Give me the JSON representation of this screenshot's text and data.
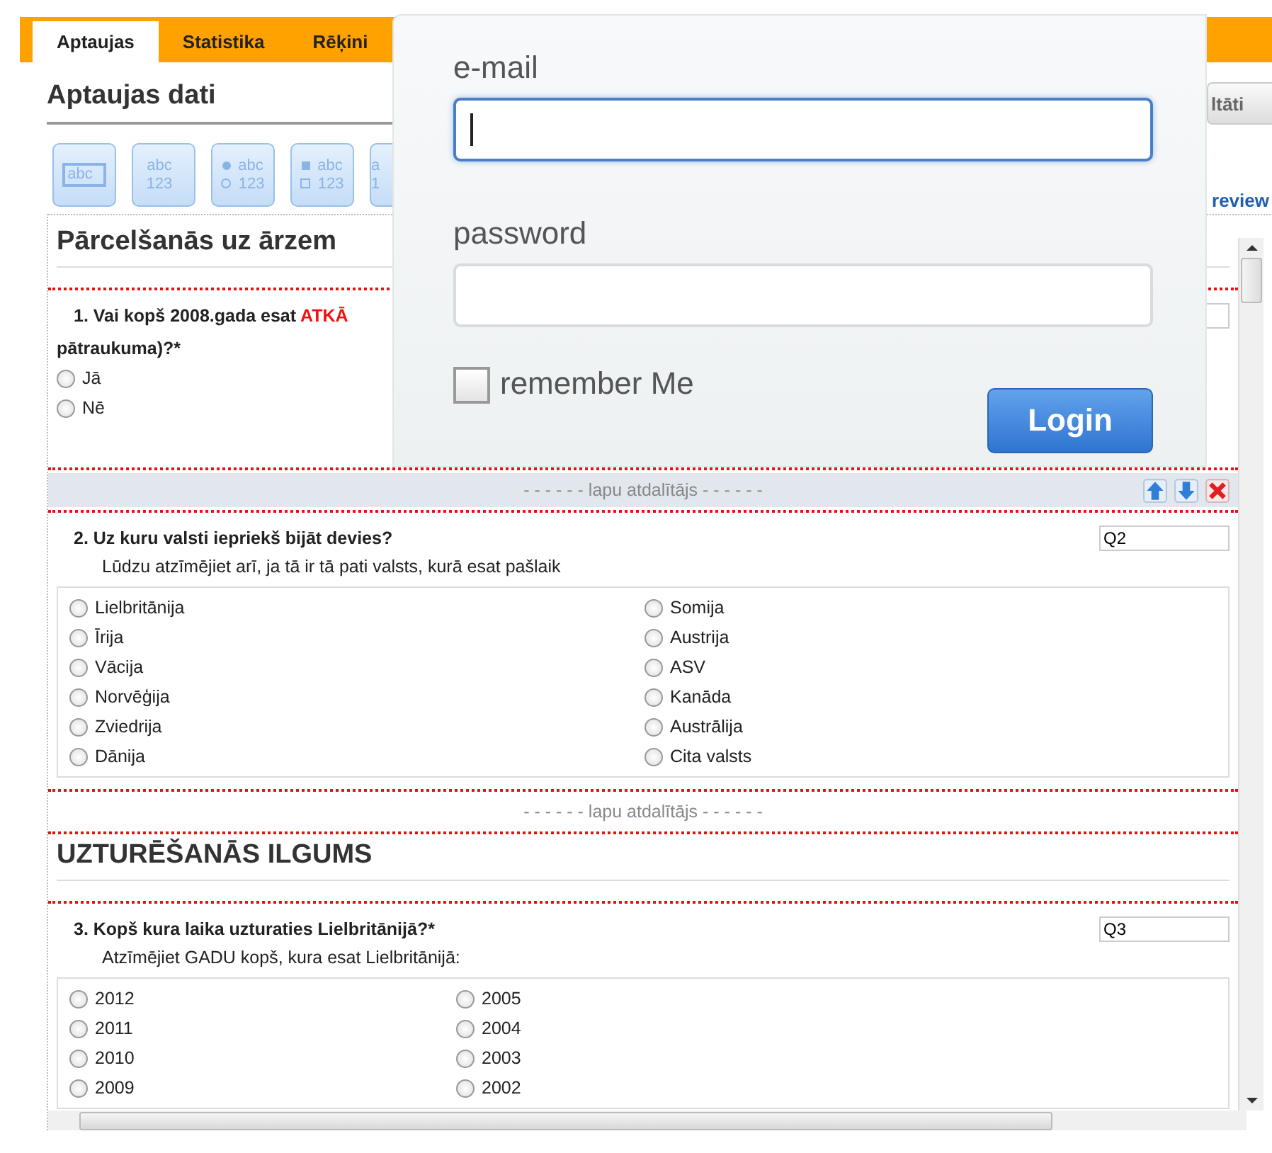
{
  "tabs": [
    {
      "label": "Aptaujas",
      "selected": true
    },
    {
      "label": "Statistika",
      "selected": false
    },
    {
      "label": "Rēķini",
      "selected": false
    }
  ],
  "page_title": "Aptaujas dati",
  "results_button": "ltāti",
  "preview_link": "review",
  "toolbar": [
    {
      "kind": "textbox",
      "line_1": "abc"
    },
    {
      "kind": "textarea",
      "line_1": "abc",
      "line_2": "123"
    },
    {
      "kind": "radio",
      "line_1": "abc",
      "line_2": "123"
    },
    {
      "kind": "checkbox",
      "line_1": "abc",
      "line_2": "123"
    },
    {
      "kind": "grid",
      "line_1": "a",
      "line_2": "1"
    }
  ],
  "blocks": [
    {
      "kind": "section_title",
      "text": "Pārcelšanās uz ārzem"
    },
    {
      "kind": "question",
      "text": "1. Vai kopš 2008.gada esat",
      "highlight": "ATKĀ",
      "text_2": "pātraukuma)?*",
      "options": [
        {
          "label": "Jā",
          "selected": false
        },
        {
          "label": "Nē",
          "selected": false
        }
      ]
    },
    {
      "kind": "page_break",
      "label": "- - - - - - lapu atdalītājs - - - - - -",
      "selected": true
    },
    {
      "kind": "question",
      "text": "2. Uz kuru valsti iepriekš bijāt devies?",
      "code": "Q2",
      "hint": "Lūdzu atzīmējiet arī, ja tā ir tā pati valsts, kurā esat pašlaik",
      "options": [
        {
          "label": "Lielbritānija",
          "selected": false
        },
        {
          "label": "Somija",
          "selected": false
        },
        {
          "label": "Īrija",
          "selected": false
        },
        {
          "label": "Austrija",
          "selected": false
        },
        {
          "label": "Vācija",
          "selected": false
        },
        {
          "label": "ASV",
          "selected": false
        },
        {
          "label": "Norvēģija",
          "selected": false
        },
        {
          "label": "Kanāda",
          "selected": false
        },
        {
          "label": "Zviedrija",
          "selected": false
        },
        {
          "label": "Austrālija",
          "selected": false
        },
        {
          "label": "Dānija",
          "selected": false
        },
        {
          "label": "Cita valsts",
          "selected": false
        }
      ]
    },
    {
      "kind": "page_break",
      "label": "- - - - - - lapu atdalītājs - - - - - -",
      "selected": false
    },
    {
      "kind": "section_title",
      "text": "UZTURĒŠANĀS ILGUMS"
    },
    {
      "kind": "question",
      "text": "3. Kopš kura laika uzturaties Lielbritānijā?*",
      "code": "Q3",
      "hint": "Atzīmējiet GADU kopš, kura esat Lielbritānijā:",
      "options": [
        {
          "label": "2012",
          "selected": false
        },
        {
          "label": "2005",
          "selected": false
        },
        {
          "label": "2011",
          "selected": false
        },
        {
          "label": "2004",
          "selected": false
        },
        {
          "label": "2010",
          "selected": false
        },
        {
          "label": "2003",
          "selected": false
        },
        {
          "label": "2009",
          "selected": false
        },
        {
          "label": "2002",
          "selected": false
        }
      ]
    }
  ],
  "login": {
    "email_label": "e-mail",
    "email_focused": true,
    "password_label": "password",
    "remember_label": "remember Me",
    "remember_checked": false,
    "button": "Login"
  }
}
